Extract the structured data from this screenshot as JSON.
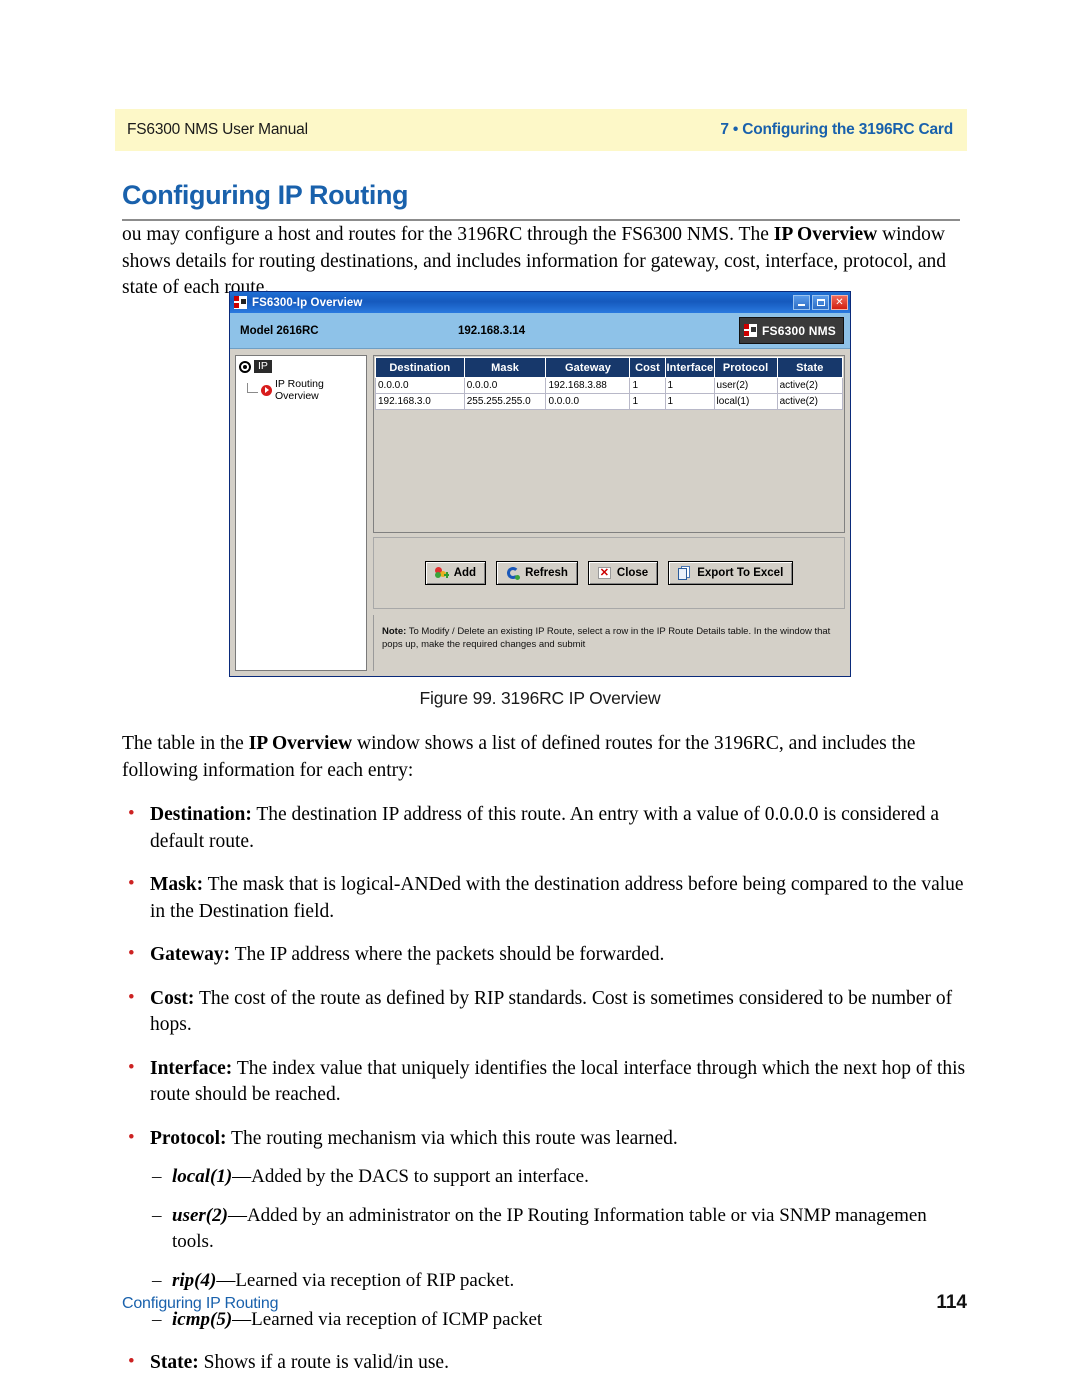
{
  "header": {
    "left": "FS6300 NMS User Manual",
    "right": "7 • Configuring the 3196RC Card"
  },
  "section": {
    "title": "Configuring IP Routing",
    "intro_html": "ou may configure a host and routes for the 3196RC through the FS6300 NMS. The <b>IP Overview</b> window shows details for routing destinations, and includes information for gateway, cost, interface, protocol, and state of each route."
  },
  "window": {
    "title": "FS6300-Ip Overview",
    "titlebar_buttons": {
      "minimize": "minimize-icon",
      "maximize": "maximize-icon",
      "close": "close-icon"
    },
    "infobar": {
      "model": "Model 2616RC",
      "ip": "192.168.3.14",
      "logo": "FS6300 NMS"
    },
    "tree": {
      "root": "IP",
      "child": "IP Routing Overview"
    },
    "table": {
      "columns": [
        "Destination",
        "Mask",
        "Gateway",
        "Cost",
        "Interface",
        "Protocol",
        "State"
      ],
      "rows": [
        [
          "0.0.0.0",
          "0.0.0.0",
          "192.168.3.88",
          "1",
          "1",
          "user(2)",
          "active(2)"
        ],
        [
          "192.168.3.0",
          "255.255.255.0",
          "0.0.0.0",
          "1",
          "1",
          "local(1)",
          "active(2)"
        ]
      ]
    },
    "buttons": [
      {
        "label": "Add",
        "icon": "add-icon"
      },
      {
        "label": "Refresh",
        "icon": "refresh-icon"
      },
      {
        "label": "Close",
        "icon": "close-icon"
      },
      {
        "label": "Export To Excel",
        "icon": "document-icon"
      }
    ],
    "note_label": "Note:",
    "note_text": " To Modify / Delete an existing IP Route, select a row in the IP Route Details table. In the window that pops up, make the required changes and submit"
  },
  "caption": "Figure 99. 3196RC IP Overview",
  "body": {
    "lead_html": "The table in the <b>IP Overview</b> window shows a list of defined routes for the 3196RC, and includes the following information for each entry:",
    "bullets": [
      {
        "term": "Destination:",
        "text": " The destination IP address of this route. An entry with a value of 0.0.0.0 is considered a default route."
      },
      {
        "term": "Mask:",
        "text": " The mask that is logical-ANDed with the destination address before being compared to the value in the Destination field."
      },
      {
        "term": "Gateway:",
        "text": " The IP address where the packets should be forwarded."
      },
      {
        "term": "Cost:",
        "text": " The cost of the route as defined by RIP standards. Cost is sometimes considered to be number of hops."
      },
      {
        "term": "Interface:",
        "text": " The index value that uniquely identifies the local interface through which the next hop of this route should be reached."
      },
      {
        "term": "Protocol:",
        "text": " The routing mechanism via which this route was learned."
      },
      {
        "term": "State:",
        "text": " Shows if a route is valid/in use."
      }
    ],
    "protocol_subitems": [
      {
        "term": "local(1)",
        "text": "—Added by the DACS to support an interface."
      },
      {
        "term": "user(2)",
        "text": "—Added by an administrator on the IP Routing Information table or via SNMP managemen tools."
      },
      {
        "term": "rip(4)",
        "text": "—Learned via reception of RIP packet."
      },
      {
        "term": "icmp(5)",
        "text": "—Learned via reception of ICMP packet"
      }
    ]
  },
  "footer": {
    "left": "Configuring IP Routing",
    "page": "114"
  },
  "colors": {
    "header_band": "#fdf8c8",
    "brand_blue": "#1961ac",
    "table_header": "#17386b",
    "bullet_red": "#cc2222",
    "window_chrome": "#d4d0c8"
  }
}
